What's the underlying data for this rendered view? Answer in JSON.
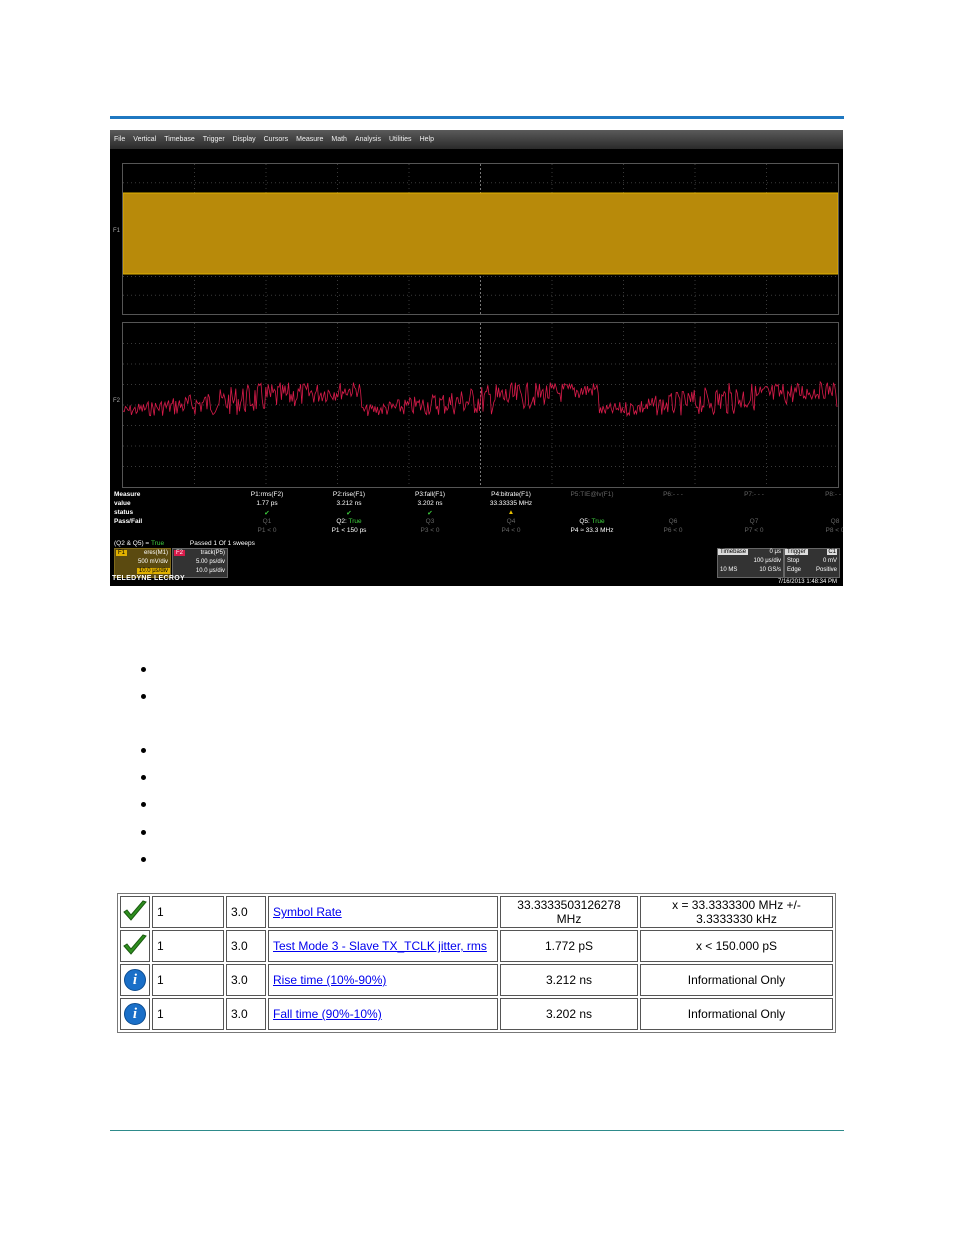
{
  "scope": {
    "menu": [
      "File",
      "Vertical",
      "Timebase",
      "Trigger",
      "Display",
      "Cursors",
      "Measure",
      "Math",
      "Analysis",
      "Utilities",
      "Help"
    ],
    "ch1_label": "F1",
    "ch2_label": "F2",
    "measure": {
      "row_labels": [
        "Measure",
        "value",
        "status",
        "Pass/Fail"
      ],
      "params": [
        {
          "name": "P1:rms(F2)",
          "value": "1.77 ps",
          "status": "✔",
          "q": "Q1",
          "cond": "P1 < 0",
          "q_active": false
        },
        {
          "name": "P2:rise(F1)",
          "value": "3.212 ns",
          "status": "✔",
          "q": "Q2:",
          "q_val": "True",
          "cond": "P1 < 150 ps",
          "q_active": true
        },
        {
          "name": "P3:fall(F1)",
          "value": "3.202 ns",
          "status": "✔",
          "q": "Q3",
          "cond": "P3 < 0",
          "q_active": false
        },
        {
          "name": "P4:bitrate(F1)",
          "value": "33.33335 MHz",
          "status": "▲",
          "q": "Q4",
          "cond": "P4 < 0",
          "q_active": false
        },
        {
          "name": "P5:TIE@lv(F1)",
          "value": "",
          "status": "",
          "q": "Q5:",
          "q_val": "True",
          "cond": "P4 ≈ 33.3 MHz",
          "q_active": true
        },
        {
          "name": "P6:- - -",
          "value": "",
          "status": "",
          "q": "Q6",
          "cond": "P6 < 0",
          "q_active": false
        },
        {
          "name": "P7:- - -",
          "value": "",
          "status": "",
          "q": "Q7",
          "cond": "P7 < 0",
          "q_active": false
        },
        {
          "name": "P8:- - -",
          "value": "",
          "status": "",
          "q": "Q8",
          "cond": "P8 < 0",
          "q_active": false
        }
      ],
      "summary_expr": "(Q2 & Q5) =",
      "summary_val": "True",
      "passed": "Passed  1   Of  1   sweeps"
    },
    "f1_tag": "F1",
    "f1_name": "eres(M1)",
    "f1_vdiv": "500 mV/div",
    "f1_tdiv": "10.0 μs/div",
    "f2_tag": "F2",
    "f2_name": "track(P5)",
    "f2_vdiv": "5.00 ps/div",
    "f2_tdiv": "10.0 μs/div",
    "timebase_label": "Timebase",
    "timebase_val": "0 μs",
    "timebase_div": "100 μs/div",
    "samples": "10 MS",
    "rate": "10 GS/s",
    "trigger_label": "Trigger",
    "trigger_ch": "C1",
    "trigger_mode": "Stop",
    "trigger_level": "0 mV",
    "trigger_type": "Edge",
    "trigger_slope": "Positive",
    "timestamp": "7/16/2013 1:48:34 PM",
    "brand": "TELEDYNE LECROY"
  },
  "table": {
    "rows": [
      {
        "icon": "check-icon",
        "col1": "1",
        "col2": "3.0",
        "test": "Symbol Rate",
        "measured": "33.3333503126278 MHz",
        "spec": "x = 33.3333300 MHz +/- 3.3333330 kHz"
      },
      {
        "icon": "check-icon",
        "col1": "1",
        "col2": "3.0",
        "test": "Test Mode 3 - Slave TX_TCLK jitter, rms",
        "measured": "1.772 pS",
        "spec": "x < 150.000 pS"
      },
      {
        "icon": "info-icon",
        "col1": "1",
        "col2": "3.0",
        "test": "Rise time (10%-90%)",
        "measured": "3.212 ns",
        "spec": "Informational Only"
      },
      {
        "icon": "info-icon",
        "col1": "1",
        "col2": "3.0",
        "test": "Fall time (90%-10%)",
        "measured": "3.202 ns",
        "spec": "Informational Only"
      }
    ]
  },
  "colors": {
    "accent_rule": "#1f78c1",
    "trace_f1": "#b88a0a",
    "trace_f2": "#d81b4a",
    "pass_green": "#2f8f1f",
    "info_blue": "#1a6fc8"
  }
}
